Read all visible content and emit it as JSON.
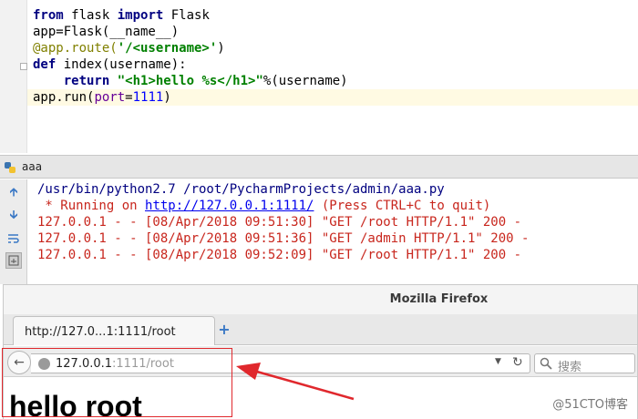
{
  "editor": {
    "lines": [
      {
        "parts": [
          {
            "t": "from",
            "c": "kw"
          },
          {
            "t": " flask ",
            "c": ""
          },
          {
            "t": "import",
            "c": "kw"
          },
          {
            "t": " Flask",
            "c": ""
          }
        ]
      },
      {
        "parts": [
          {
            "t": "app=Flask(__name__)",
            "c": ""
          }
        ]
      },
      {
        "parts": [
          {
            "t": "@app.route(",
            "c": "dec"
          },
          {
            "t": "'/<username>'",
            "c": "str"
          },
          {
            "t": ")",
            "c": ""
          }
        ]
      },
      {
        "parts": [
          {
            "t": "def",
            "c": "kw"
          },
          {
            "t": " index(username):",
            "c": ""
          }
        ]
      },
      {
        "parts": [
          {
            "t": "    ",
            "c": ""
          },
          {
            "t": "return",
            "c": "kw"
          },
          {
            "t": " ",
            "c": ""
          },
          {
            "t": "\"<h1>hello %s</h1>\"",
            "c": "str"
          },
          {
            "t": "%(username)",
            "c": ""
          }
        ]
      },
      {
        "parts": [
          {
            "t": "app.run(",
            "c": ""
          },
          {
            "t": "port",
            "c": "prm"
          },
          {
            "t": "=",
            "c": ""
          },
          {
            "t": "1111",
            "c": "num"
          },
          {
            "t": ")",
            "c": ""
          }
        ]
      }
    ]
  },
  "run_panel": {
    "title": "aaa",
    "toolbar_icons": [
      "arrow-up-icon",
      "arrow-down-icon",
      "soft-wrap-icon",
      "scroll-to-end-icon"
    ],
    "console": {
      "command": "/usr/bin/python2.7 /root/PycharmProjects/admin/aaa.py",
      "running_prefix": " * Running on ",
      "running_link": "http://127.0.0.1:1111/",
      "running_suffix": " (Press CTRL+C to quit)",
      "log_lines": [
        "127.0.0.1 - - [08/Apr/2018 09:51:30] \"GET /root HTTP/1.1\" 200 -",
        "127.0.0.1 - - [08/Apr/2018 09:51:36] \"GET /admin HTTP/1.1\" 200 -",
        "127.0.0.1 - - [08/Apr/2018 09:52:09] \"GET /root HTTP/1.1\" 200 -"
      ]
    }
  },
  "browser": {
    "window_title": "Mozilla Firefox",
    "tab_label": "http://127.0...1:1111/root",
    "url_host": "127.0.0.1",
    "url_rest": ":1111/root",
    "search_placeholder": "搜索",
    "page_heading": "hello root"
  },
  "watermark": "@51CTO博客",
  "colors": {
    "annotation": "#e0282d",
    "console_text": "#c8261d",
    "link": "#0000ee"
  }
}
